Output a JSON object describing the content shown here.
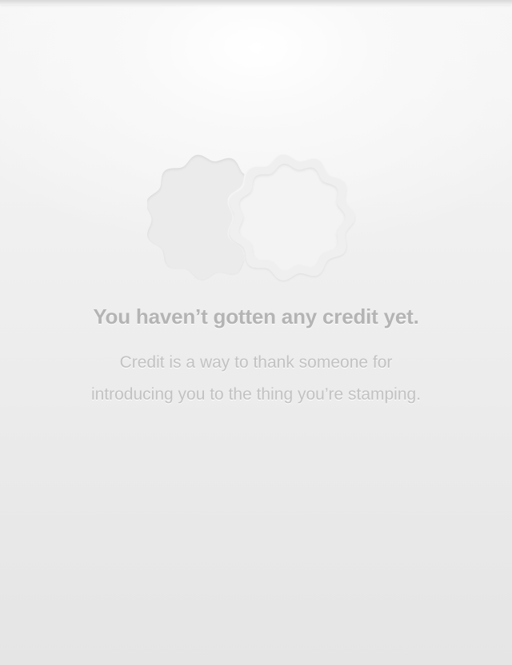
{
  "empty_state": {
    "icon": "overlapping-stamps-icon",
    "title": "You haven’t gotten any credit yet.",
    "description_lines": [
      "Credit is a way to thank someone for",
      "introducing you to the thing you’re stamping."
    ]
  },
  "colors": {
    "title": "#b4b4b4",
    "description": "#c2c2c2",
    "stamp_fill": "#ebebeb"
  }
}
